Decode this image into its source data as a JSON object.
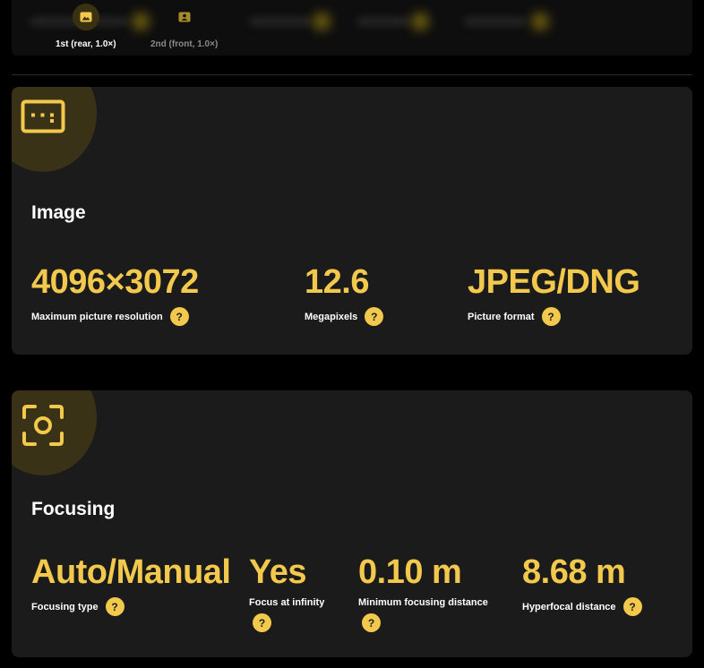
{
  "camera_tabs": [
    {
      "label": "1st (rear, 1.0×)",
      "active": true,
      "icon": "mountain-landscape-icon"
    },
    {
      "label": "2nd (front, 1.0×)",
      "active": false,
      "icon": "portrait-person-icon"
    }
  ],
  "image_section": {
    "title": "Image",
    "icon": "aspect-ratio-icon",
    "stats": [
      {
        "value": "4096×3072",
        "label": "Maximum picture resolution"
      },
      {
        "value": "12.6",
        "label": "Megapixels"
      },
      {
        "value": "JPEG/DNG",
        "label": "Picture format"
      }
    ]
  },
  "focusing_section": {
    "title": "Focusing",
    "icon": "focus-frame-icon",
    "stats": [
      {
        "value": "Auto/Manual",
        "label": "Focusing type"
      },
      {
        "value": "Yes",
        "label": "Focus at infinity"
      },
      {
        "value": "0.10 m",
        "label": "Minimum focusing distance"
      },
      {
        "value": "8.68 m",
        "label": "Hyperfocal distance"
      }
    ]
  },
  "help_glyph": "?",
  "colors": {
    "accent": "#f2c94c",
    "card_bg": "#1b1b1b",
    "page_bg": "#000000"
  }
}
